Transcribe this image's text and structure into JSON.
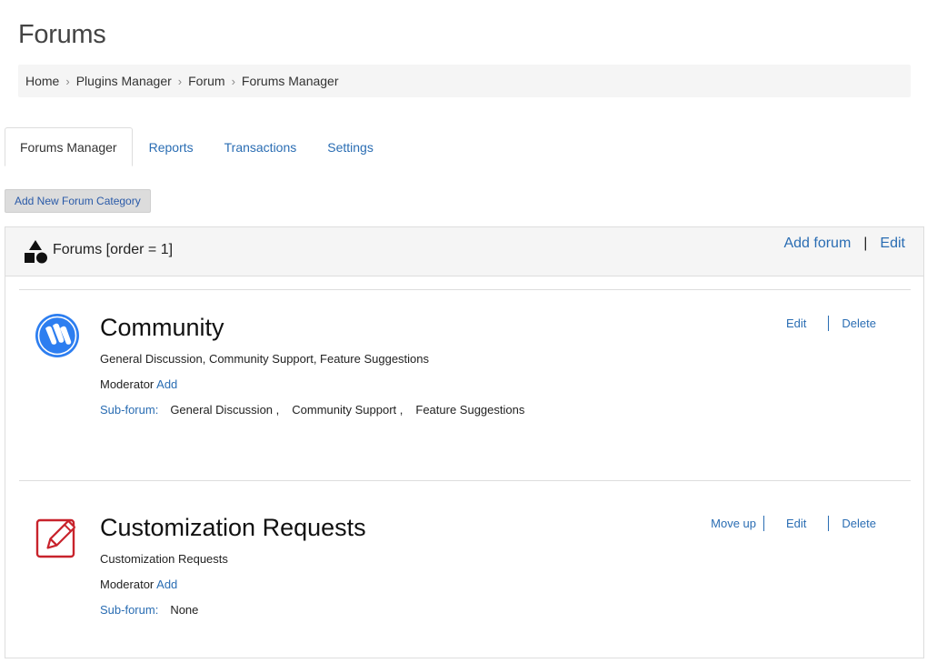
{
  "page": {
    "title": "Forums"
  },
  "breadcrumb": [
    {
      "label": "Home"
    },
    {
      "label": "Plugins Manager"
    },
    {
      "label": "Forum"
    },
    {
      "label": "Forums Manager"
    }
  ],
  "tabs": [
    {
      "label": "Forums Manager",
      "active": true
    },
    {
      "label": "Reports",
      "active": false
    },
    {
      "label": "Transactions",
      "active": false
    },
    {
      "label": "Settings",
      "active": false
    }
  ],
  "add_category_label": "Add New Forum Category",
  "panel": {
    "icon": "shapes-icon",
    "title": "Forums [order = 1]",
    "add_forum_label": "Add forum",
    "separator": "|",
    "edit_label": "Edit"
  },
  "forums": [
    {
      "icon": "steem-logo-icon",
      "name": "Community",
      "description": "General Discussion, Community Support, Feature Suggestions",
      "moderator_label": "Moderator",
      "moderator_add": "Add",
      "subforum_label": "Sub-forum:",
      "subforums": [
        "General Discussion ,",
        "Community Support ,",
        "Feature Suggestions"
      ],
      "actions": {
        "edit": "Edit",
        "delete": "Delete"
      }
    },
    {
      "icon": "pencil-edit-icon",
      "name": "Customization Requests",
      "description": "Customization Requests",
      "moderator_label": "Moderator",
      "moderator_add": "Add",
      "subforum_label": "Sub-forum:",
      "subforum_none": "None",
      "actions": {
        "move_up": "Move up",
        "edit": "Edit",
        "delete": "Delete"
      }
    }
  ],
  "colors": {
    "link": "#2a6db3",
    "icon_blue": "#2d7ef0",
    "icon_red": "#c8232c",
    "panel_head_bg": "#f5f5f5"
  }
}
